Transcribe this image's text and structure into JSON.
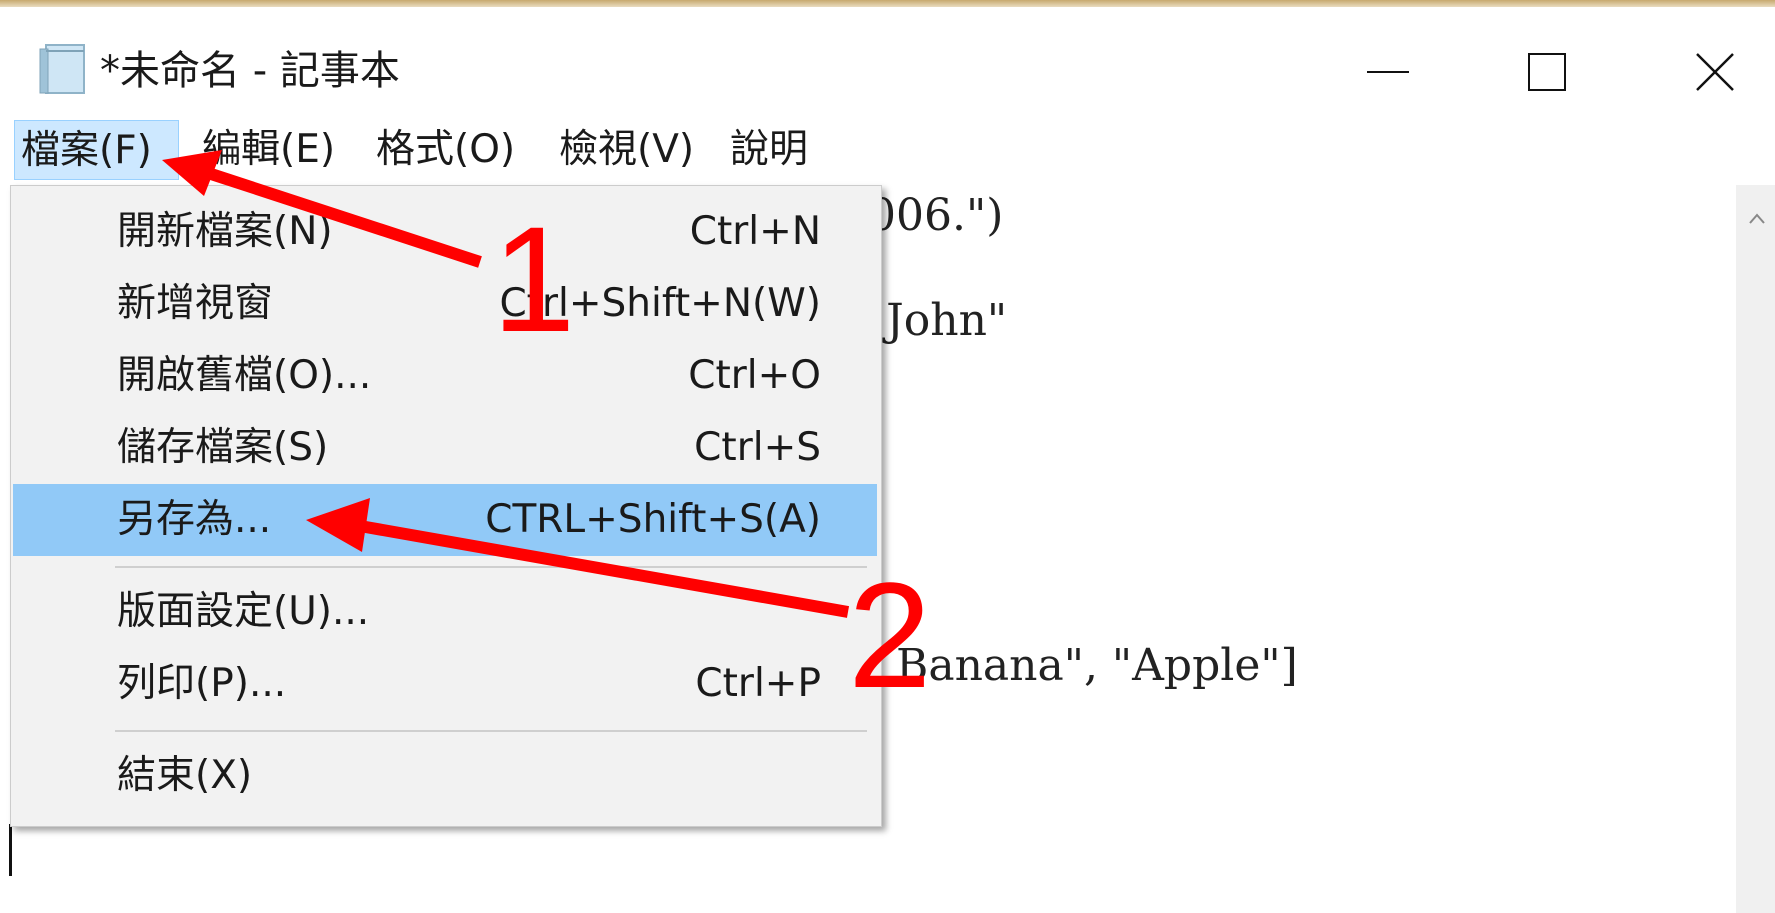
{
  "window": {
    "title": "*未命名 - 記事本",
    "controls": [
      "minimize",
      "maximize",
      "close"
    ]
  },
  "menubar": {
    "items": [
      {
        "label": "檔案(F)",
        "active": true
      },
      {
        "label": "編輯(E)"
      },
      {
        "label": "格式(O)"
      },
      {
        "label": "檢視(V)"
      },
      {
        "label": "說明"
      }
    ]
  },
  "editor": {
    "lines": [
      "006.\")",
      "'John\"",
      "Banana\", \"Apple\"]"
    ]
  },
  "file_menu": {
    "items": [
      {
        "label": "開新檔案(N)",
        "shortcut": "Ctrl+N"
      },
      {
        "label": "新增視窗",
        "shortcut": "Ctrl+Shift+N(W)"
      },
      {
        "label": "開啟舊檔(O)...",
        "shortcut": "Ctrl+O"
      },
      {
        "label": "儲存檔案(S)",
        "shortcut": "Ctrl+S"
      },
      {
        "label": "另存為...",
        "shortcut": "CTRL+Shift+S(A)",
        "highlighted": true
      },
      {
        "label": "版面設定(U)...",
        "shortcut": ""
      },
      {
        "label": "列印(P)...",
        "shortcut": "Ctrl+P"
      },
      {
        "label": "結束(X)",
        "shortcut": ""
      }
    ]
  },
  "annotations": {
    "step1": "1",
    "step2": "2",
    "color": "#ff0000"
  },
  "colors": {
    "menu_active": "#cde8ff",
    "menu_highlight": "#91c9f7",
    "dropdown_bg": "#f2f2f2"
  }
}
